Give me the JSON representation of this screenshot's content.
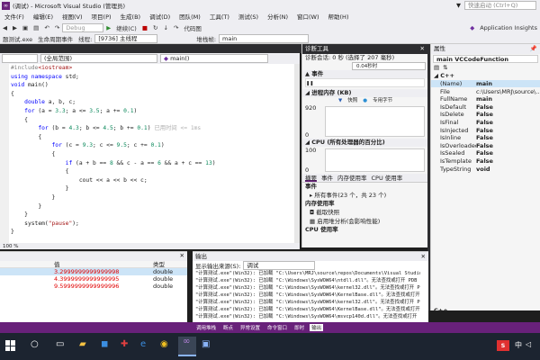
{
  "window": {
    "title": "(调试) - Microsoft Visual Studio (管理员)",
    "quick_launch": "快速启动 (Ctrl+Q)"
  },
  "menu": [
    "文件(F)",
    "编辑(E)",
    "视图(V)",
    "项目(P)",
    "生成(B)",
    "调试(D)",
    "团队(M)",
    "工具(T)",
    "测试(S)",
    "分析(N)",
    "窗口(W)",
    "帮助(H)"
  ],
  "toolbar": {
    "config": "Debug",
    "continue": "继续(C)",
    "code_map": "代码图",
    "insights": "Application Insights"
  },
  "toolbar2": {
    "process": "题测试.exe",
    "lifecycle": "生命周期事件",
    "thread_label": "线程:",
    "thread": "[9736] 主线程",
    "stack_label": "堆栈帧:",
    "stack": "main"
  },
  "editor": {
    "scope": "(全局范围)",
    "func": "main()",
    "zoom": "100 %",
    "elapsed_hint": "已用时间 <= 1ms",
    "lines": [
      {
        "t": "#include<iostream>"
      },
      {
        "t": "using namespace std;"
      },
      {
        "t": "void main()"
      },
      {
        "t": "{"
      },
      {
        "t": "    double a, b, c;"
      },
      {
        "t": "    for (a = 3.3; a <= 3.5; a += 0.1)"
      },
      {
        "t": "    {"
      },
      {
        "t": "        for (b = 4.3; b <= 4.5; b += 0.1)"
      },
      {
        "t": "        {"
      },
      {
        "t": "            for (c = 9.3; c <= 9.5; c += 0.1)"
      },
      {
        "t": "            {"
      },
      {
        "t": "                if (a + b == 8 && c - a == 6 && a + c == 13)"
      },
      {
        "t": "                {"
      },
      {
        "t": "                    cout << a << b << c;"
      },
      {
        "t": "                }"
      },
      {
        "t": "            }"
      },
      {
        "t": "        }"
      },
      {
        "t": "    }"
      },
      {
        "t": "    system(\"pause\");"
      },
      {
        "t": "}"
      }
    ]
  },
  "diagnostics": {
    "title": "诊断工具",
    "session": "诊断会话: 0 秒 (选择了 207 毫秒)",
    "time_tick": "0.04秒时",
    "events": "▲ 事件",
    "memory": "◢ 进程内存 (KB)",
    "memory_legend_a": "快照",
    "memory_legend_b": "专用字节",
    "mem_top": "920",
    "mem_bottom": "0",
    "cpu": "◢ CPU (所有处理器的百分比)",
    "cpu_top": "100",
    "cpu_bottom": "0",
    "tabs": [
      "摘要",
      "事件",
      "内存使用率",
      "CPU 使用率"
    ],
    "ev_section": "事件",
    "all_events": "所有事件(23 个，共 23 个)",
    "mem_usage": "内存使用率",
    "snapshot": "截取快照",
    "heap_analysis": "启用堆分析(会影响性能)",
    "cpu_usage": "CPU 使用率"
  },
  "properties": {
    "title": "属性",
    "object": "main  VCCodeFunction",
    "category": "C++",
    "rows": [
      {
        "k": "(Name)",
        "v": "main"
      },
      {
        "k": "File",
        "v": "c:\\Users\\MRJ\\source\\..."
      },
      {
        "k": "FullName",
        "v": "main"
      },
      {
        "k": "IsDefault",
        "v": "False"
      },
      {
        "k": "IsDelete",
        "v": "False"
      },
      {
        "k": "IsFinal",
        "v": "False"
      },
      {
        "k": "IsInjected",
        "v": "False"
      },
      {
        "k": "IsInline",
        "v": "False"
      },
      {
        "k": "IsOverloaded",
        "v": "False"
      },
      {
        "k": "IsSealed",
        "v": "False"
      },
      {
        "k": "IsTemplate",
        "v": "False"
      },
      {
        "k": "TypeString",
        "v": "void"
      }
    ],
    "footer": "C++"
  },
  "locals": {
    "header_value": "值",
    "header_type": "类型",
    "rows": [
      {
        "v": "3.2999999999999998",
        "t": "double"
      },
      {
        "v": "4.3999999999999995",
        "t": "double"
      },
      {
        "v": "9.5999999999999996",
        "t": "double"
      }
    ]
  },
  "output": {
    "title": "输出",
    "show_from": "显示输出来源(S):",
    "source": "调试",
    "lines": [
      "\"计算测试.exe\"(Win32): 已加载 \"C:\\Users\\MRJ\\source\\repos\\Documents\\Visual Studio 2017\\Projects\\...",
      "\"计算测试.exe\"(Win32): 已加载 \"C:\\Windows\\SysWOW64\\ntdll.dll\"。无法查找或打开 PDB",
      "\"计算测试.exe\"(Win32): 已加载 \"C:\\Windows\\SysWOW64\\kernel32.dll\"。无法查找或打开 P",
      "\"计算测试.exe\"(Win32): 已加载 \"C:\\Windows\\SysWOW64\\KernelBase.dll\"。无法查找或打开 P",
      "\"计算测试.exe\"(Win32): 已加载 \"C:\\Windows\\SysWOW64\\kernel32.dll\"。无法查找或打开 P",
      "\"计算测试.exe\"(Win32): 已加载 \"C:\\Windows\\SysWOW64\\KernelBase.dll\"。无法查找或打开 P",
      "\"计算测试.exe\"(Win32): 已加载 \"C:\\Windows\\SysWOW64\\msvcp140d.dll\"。无法查找或打开"
    ],
    "tabs": [
      "调用堆栈",
      "断点",
      "异常设置",
      "命令窗口",
      "即时"
    ]
  },
  "taskbar": {
    "tray_ime": "S",
    "tray_lang": "中"
  }
}
